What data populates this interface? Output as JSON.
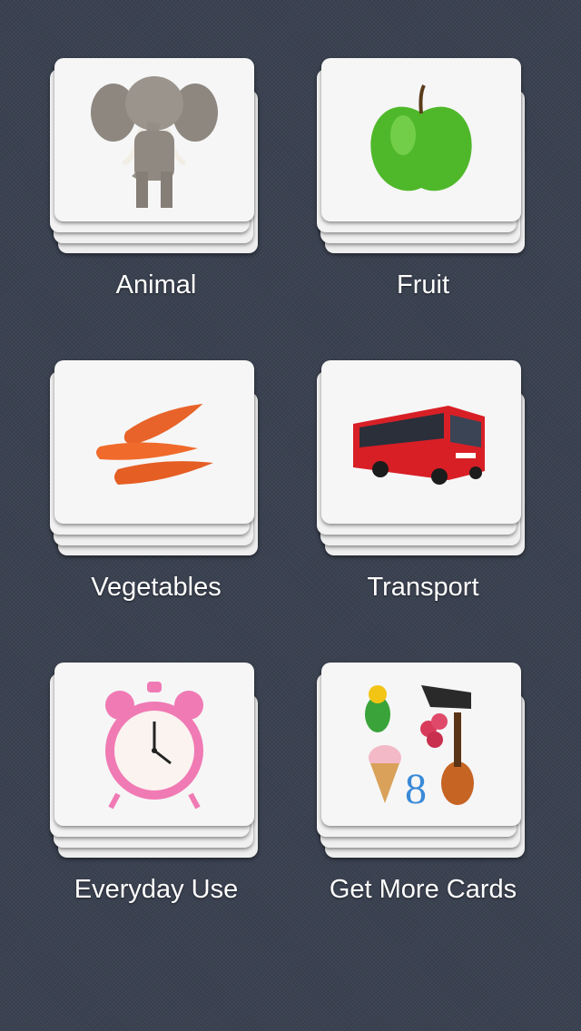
{
  "categories": [
    {
      "label": "Animal",
      "icon": "elephant-icon"
    },
    {
      "label": "Fruit",
      "icon": "green-apple-icon"
    },
    {
      "label": "Vegetables",
      "icon": "carrots-icon"
    },
    {
      "label": "Transport",
      "icon": "red-bus-icon"
    },
    {
      "label": "Everyday Use",
      "icon": "alarm-clock-icon"
    },
    {
      "label": "Get More Cards",
      "icon": "mixed-items-icon"
    }
  ],
  "colors": {
    "background": "#3a4150",
    "card": "#f4f4f4",
    "label": "#ffffff"
  }
}
